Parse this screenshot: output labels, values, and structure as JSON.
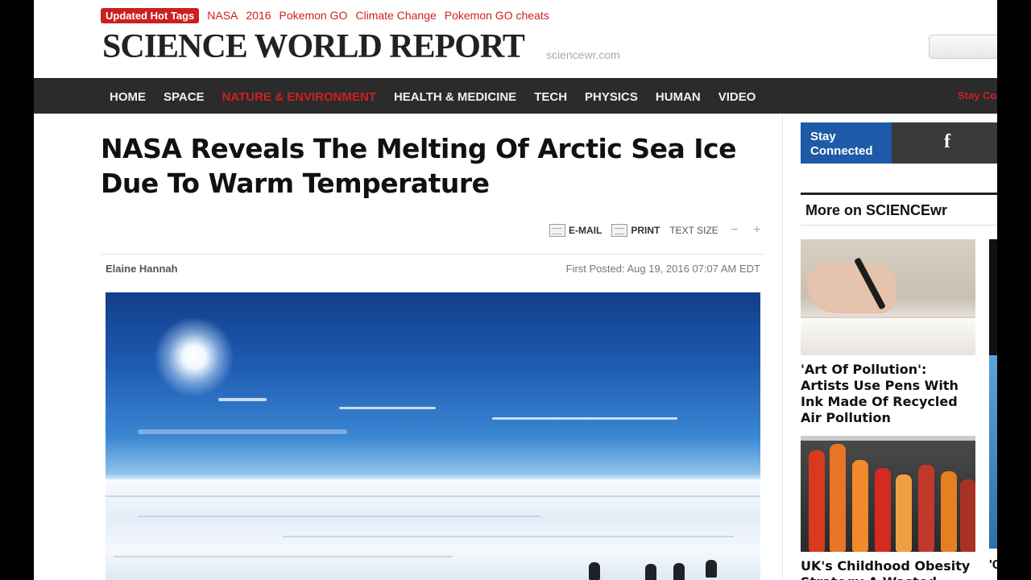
{
  "hot_tags": {
    "label": "Updated Hot Tags",
    "tags": [
      "NASA",
      "2016",
      "Pokemon GO",
      "Climate Change",
      "Pokemon GO cheats"
    ]
  },
  "site": {
    "logo": "SCIENCE WORLD REPORT",
    "domain": "sciencewr.com"
  },
  "nav": {
    "items": [
      "HOME",
      "SPACE",
      "NATURE & ENVIRONMENT",
      "HEALTH & MEDICINE",
      "TECH",
      "PHYSICS",
      "HUMAN",
      "VIDEO"
    ],
    "active_index": 2,
    "stay_connected": "Stay Co"
  },
  "article": {
    "headline": "NASA Reveals The Melting Of Arctic Sea Ice Due To Warm Temperature",
    "tools": {
      "email": "E-MAIL",
      "print": "PRINT",
      "text_size": "TEXT SIZE",
      "decrease": "−",
      "increase": "+"
    },
    "author": "Elaine Hannah",
    "first_posted": "First Posted: Aug 19, 2016 07:07 AM EDT"
  },
  "sidebar": {
    "stay_connected": "Stay Connected",
    "facebook_icon": "f",
    "more_title": "More on SCIENCEwr",
    "stories": [
      {
        "title": "'Art Of Pollution': Artists Use Pens With Ink Made Of Recycled Air Pollution"
      },
      {
        "title": "UK's Childhood Obesity Strategy A Wasted"
      }
    ],
    "clipped_text": "'C"
  },
  "colors": {
    "accent_red": "#d11f1f",
    "nav_bg": "#2b2b2b",
    "stay_blue": "#1e5aa7"
  }
}
